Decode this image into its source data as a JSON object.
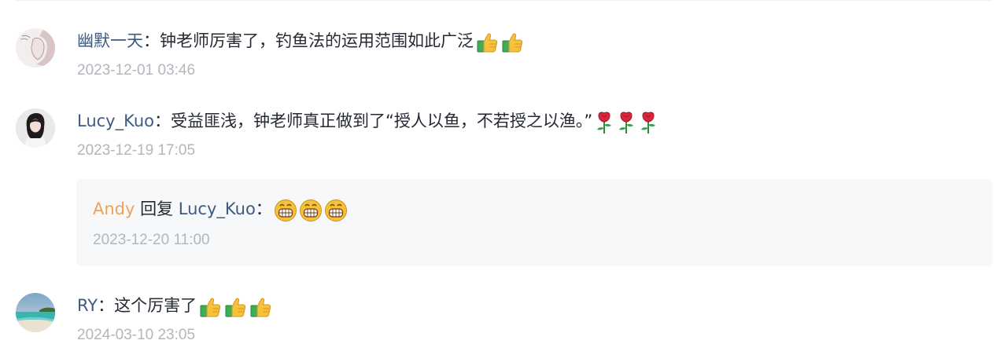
{
  "comments": [
    {
      "author": "幽默一天",
      "separator": "：",
      "text": "钟老师厉害了，钓鱼法的运用范围如此广泛",
      "emoji": [
        "thumbs-up",
        "thumbs-up"
      ],
      "time": "2023-12-01 03:46"
    },
    {
      "author": "Lucy_Kuo",
      "separator": "：",
      "text": "受益匪浅，钟老师真正做到了“授人以鱼，不若授之以渔。”",
      "emoji": [
        "rose",
        "rose",
        "rose"
      ],
      "time": "2023-12-19 17:05",
      "reply": {
        "author": "Andy",
        "verb": " 回复 ",
        "target": "Lucy_Kuo",
        "separator": "：",
        "emoji": [
          "grin",
          "grin",
          "grin"
        ],
        "time": "2023-12-20 11:00"
      }
    },
    {
      "author": "RY",
      "separator": "：",
      "text": "这个厉害了",
      "emoji": [
        "thumbs-up",
        "thumbs-up",
        "thumbs-up"
      ],
      "time": "2024-03-10 23:05"
    }
  ],
  "colors": {
    "author": "#3f5a80",
    "reply_author": "#f0a25a",
    "text": "#252933",
    "time": "#b2b6bd",
    "reply_bg": "#f7f8fa"
  }
}
